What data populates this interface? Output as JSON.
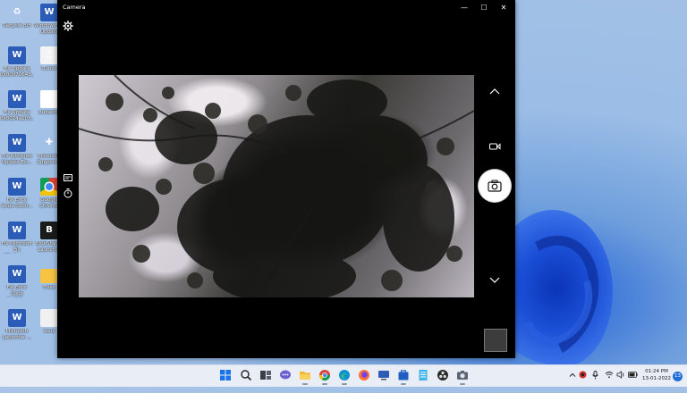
{
  "desktop": {
    "icons": [
      {
        "label": "Recycle Bin",
        "glyph": "♻"
      },
      {
        "label": "Fix Update 0x80070643...",
        "glyph": "W"
      },
      {
        "label": "Fix Update 0x8024a105...",
        "glyph": "W"
      },
      {
        "label": "Fix Windows Update Err...",
        "glyph": "W"
      },
      {
        "label": "Fix Error Code 0xC0...",
        "glyph": "W"
      },
      {
        "label": "Fix Microsoft Fix Windows...",
        "glyph": "W"
      },
      {
        "label": "Fix Error Code 0xC00...",
        "glyph": "W"
      },
      {
        "label": "Microsoft Launcher ...",
        "glyph": "W"
      },
      {
        "label": "Windows Fix Update",
        "glyph": "W"
      },
      {
        "label": "iTunes",
        "glyph": "♫"
      },
      {
        "label": "Audacity",
        "glyph": "W"
      },
      {
        "label": "Microsoft Support...",
        "glyph": "✚"
      },
      {
        "label": "Google Chrome",
        "glyph": ""
      },
      {
        "label": "BlueStacks Launcher",
        "glyph": "B"
      },
      {
        "label": "Fixes",
        "glyph": ""
      },
      {
        "label": "asus",
        "glyph": ""
      }
    ]
  },
  "camera_window": {
    "title": "Camera",
    "controls": {
      "minimize": "—",
      "maximize": "☐",
      "close": "✕"
    }
  },
  "taskbar": {
    "apps": [
      "windows-start",
      "search",
      "task-view",
      "chat",
      "file-explorer",
      "chrome",
      "edge",
      "firefox",
      "media-player",
      "store",
      "notepad",
      "obs",
      "camera"
    ],
    "clock_time": "01:24 PM",
    "clock_date": "13-01-2022",
    "notification_count": "13"
  },
  "colors": {
    "window_bg": "#000000",
    "taskbar_bg": "#e9eef6",
    "accent": "#1f6fd6",
    "wallpaper": "#1a4fd6"
  }
}
